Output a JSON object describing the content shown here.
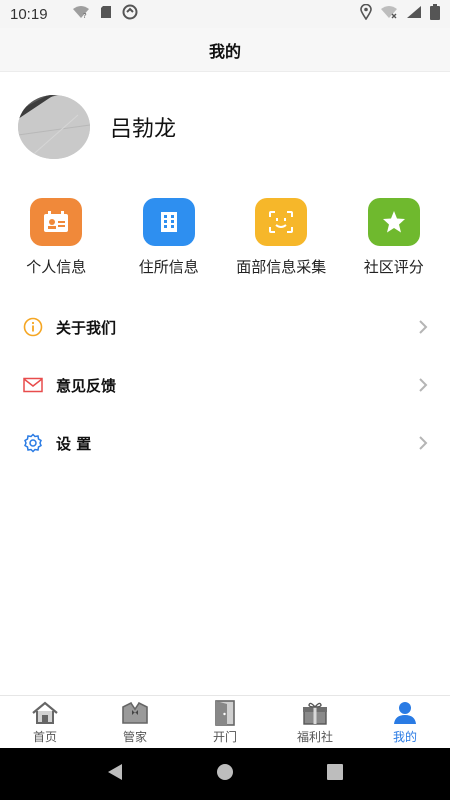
{
  "status_bar": {
    "time": "10:19"
  },
  "header": {
    "title": "我的"
  },
  "profile": {
    "name": "吕勃龙"
  },
  "quick_actions": [
    {
      "label": "个人信息",
      "icon": "id-card-icon",
      "color": "#f0893a"
    },
    {
      "label": "住所信息",
      "icon": "building-icon",
      "color": "#2e8ff0"
    },
    {
      "label": "面部信息采集",
      "icon": "face-scan-icon",
      "color": "#f6b72a"
    },
    {
      "label": "社区评分",
      "icon": "star-icon",
      "color": "#6fb92e"
    }
  ],
  "menu": [
    {
      "label": "关于我们",
      "icon": "info-icon",
      "color": "#f5a623"
    },
    {
      "label": "意见反馈",
      "icon": "mail-icon",
      "color": "#e84c4c"
    },
    {
      "label": "设  置",
      "icon": "gear-icon",
      "color": "#2a7be4"
    }
  ],
  "tabs": [
    {
      "label": "首页",
      "icon": "home-icon"
    },
    {
      "label": "管家",
      "icon": "butler-icon"
    },
    {
      "label": "开门",
      "icon": "door-icon"
    },
    {
      "label": "福利社",
      "icon": "gift-icon"
    },
    {
      "label": "我的",
      "icon": "person-icon",
      "active": true
    }
  ],
  "colors": {
    "active_tab": "#2a7be4",
    "inactive_tab": "#555555"
  }
}
